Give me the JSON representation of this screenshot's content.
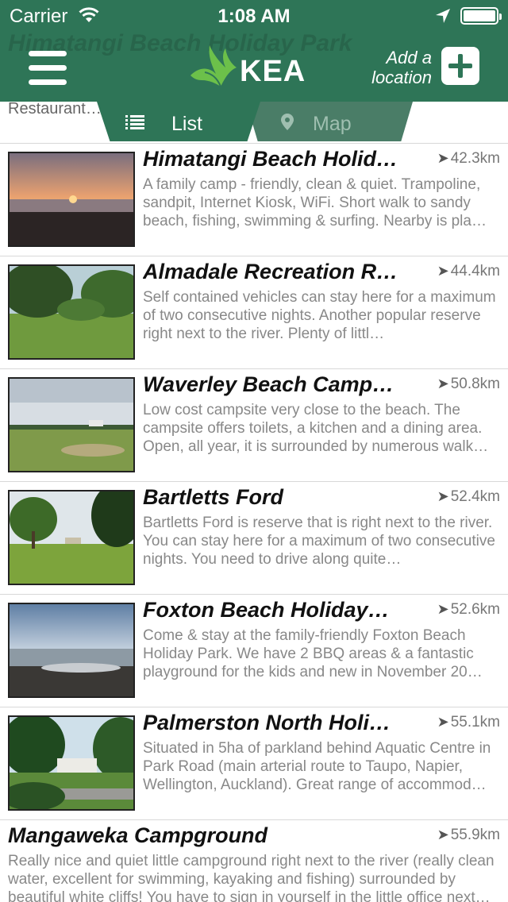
{
  "status_bar": {
    "carrier": "Carrier",
    "time": "1:08 AM"
  },
  "header": {
    "ghost_title": "Himatangi Beach Holiday Park",
    "logo_text": "KEA",
    "add_label_line1": "Add a",
    "add_label_line2": "location",
    "color": "#2e7557"
  },
  "tabs": {
    "ghost_snippet": "Restaurant…",
    "list_label": "List",
    "map_label": "Map",
    "active": "list"
  },
  "places": [
    {
      "title": "Himatangi Beach Holid…",
      "distance": "42.3km",
      "thumb": "sunset-beach",
      "description": "A family camp - friendly, clean & quiet. Trampoline, sandpit, Internet Kiosk, WiFi. Short walk to sandy beach, fishing, swimming & surfing. Nearby is pla…"
    },
    {
      "title": "Almadale Recreation R…",
      "distance": "44.4km",
      "thumb": "trees-grass",
      "description": "Self contained vehicles can stay here for a maximum of two consecutive nights. Another popular reserve right next to the river. Plenty of littl…"
    },
    {
      "title": "Waverley Beach Camp…",
      "distance": "50.8km",
      "thumb": "open-field",
      "description": "Low cost campsite very close to the beach. The campsite offers toilets, a kitchen and a dining area. Open, all year, it is surrounded by numerous walk…"
    },
    {
      "title": "Bartletts Ford",
      "distance": "52.4km",
      "thumb": "river-reserve",
      "description": "Bartletts Ford is reserve that is right next to the river. You can stay here for a maximum of two consecutive nights. You need to drive along quite…"
    },
    {
      "title": "Foxton Beach Holiday…",
      "distance": "52.6km",
      "thumb": "grey-beach",
      "description": "Come & stay at the family-friendly Foxton Beach Holiday Park. We have 2 BBQ areas & a fantastic playground for the kids and new in November 20…"
    },
    {
      "title": "Palmerston North Holi…",
      "distance": "55.1km",
      "thumb": "park-buildings",
      "description": "Situated in 5ha of parkland behind Aquatic Centre in Park Road (main arterial route to Taupo, Napier, Wellington, Auckland). Great range of accommod…"
    },
    {
      "title": "Mangaweka Campground",
      "distance": "55.9km",
      "thumb": "",
      "description": "Really nice and quiet little campground right next to the river (really clean water, excellent for swimming, kayaking and fishing) surrounded by beautiful white cliffs! You have to sign in yourself in the little office next…"
    }
  ]
}
